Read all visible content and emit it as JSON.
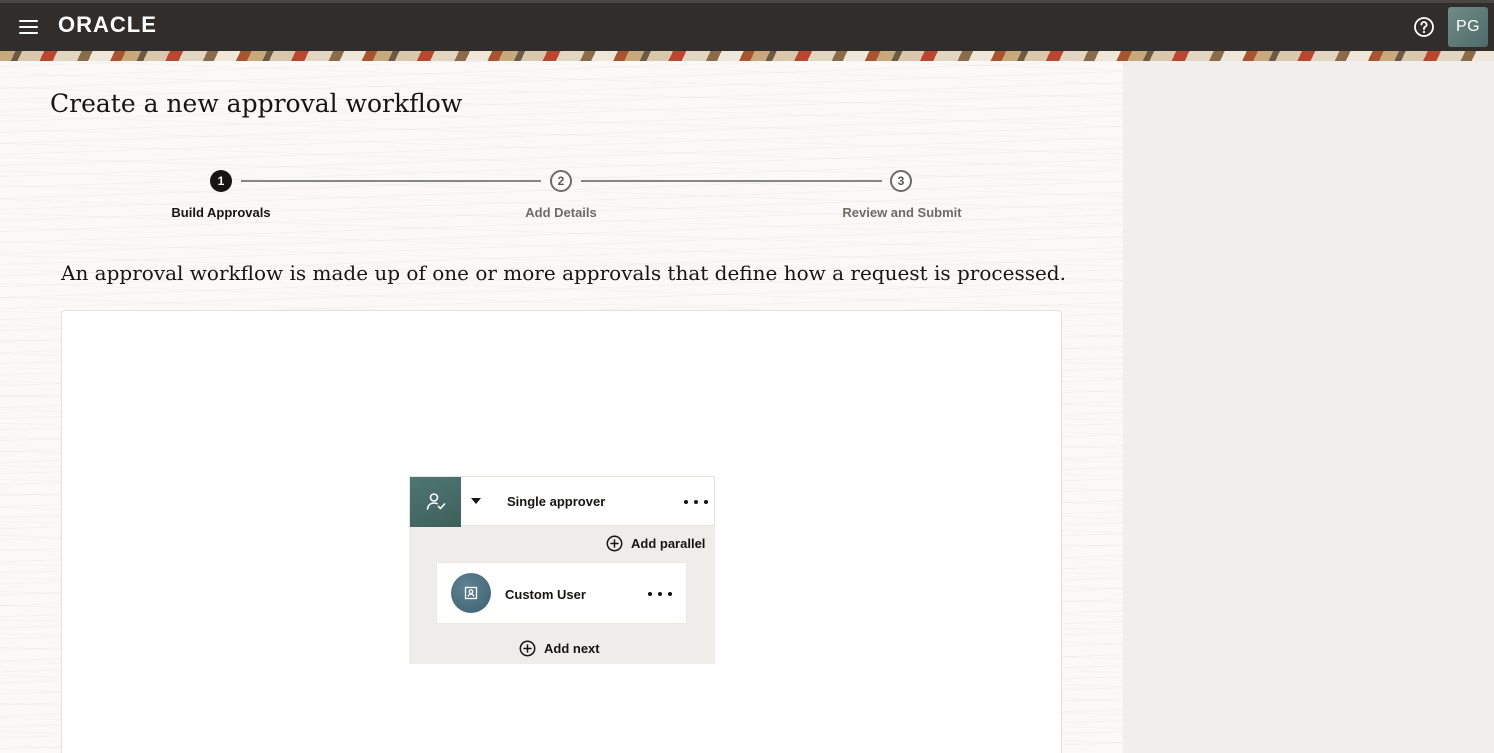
{
  "header": {
    "logo_text": "ORACLE",
    "help_icon": "question-circle-icon",
    "user_initials": "PG"
  },
  "page": {
    "title": "Create a new approval workflow",
    "description": "An approval workflow is made up of one or more approvals that define how a request is processed."
  },
  "train": {
    "steps": [
      {
        "number": "1",
        "label": "Build Approvals",
        "state": "active"
      },
      {
        "number": "2",
        "label": "Add Details",
        "state": "inactive"
      },
      {
        "number": "3",
        "label": "Review and Submit",
        "state": "inactive"
      }
    ]
  },
  "workflow": {
    "approval": {
      "icon": "user-check-icon",
      "label": "Single approver",
      "menu_icon": "more-horizontal-icon"
    },
    "add_parallel_label": "Add parallel",
    "user_card": {
      "icon": "contact-card-icon",
      "label": "Custom User",
      "menu_icon": "more-horizontal-icon"
    },
    "add_next_label": "Add next"
  },
  "colors": {
    "header_bg": "#312d2a",
    "accent_teal": "#4f7672",
    "active_step": "#161513",
    "inactive_step": "#6f6a66"
  }
}
